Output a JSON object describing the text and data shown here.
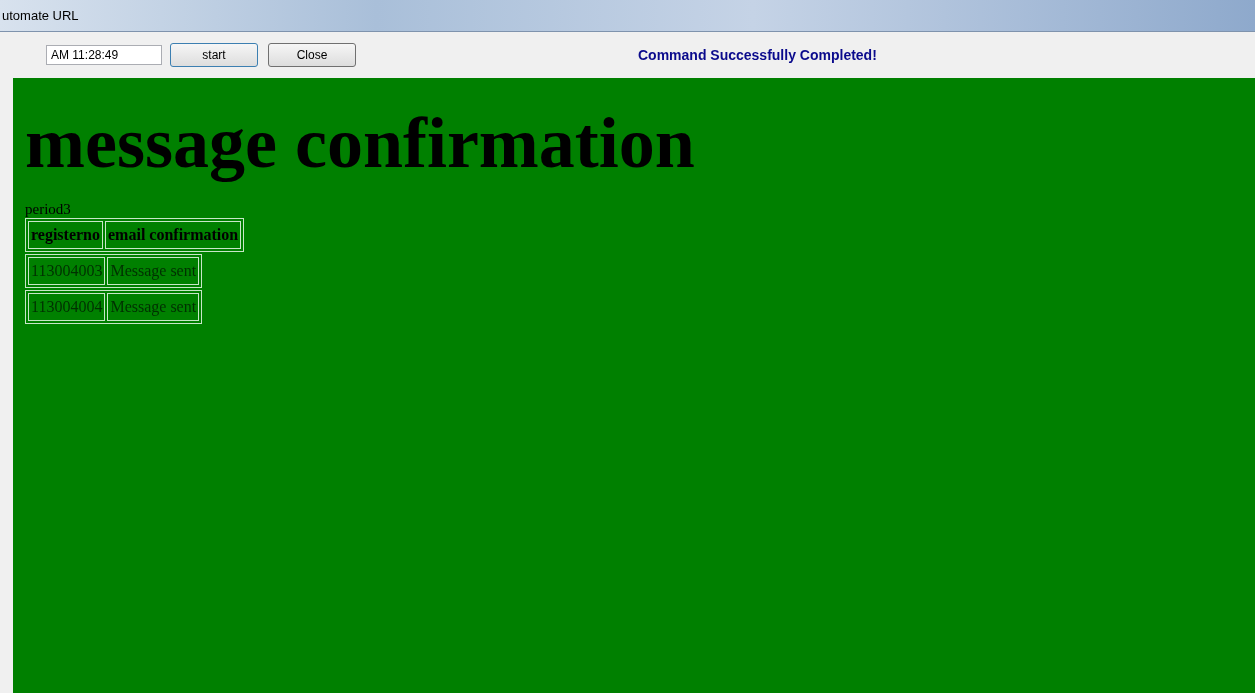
{
  "window": {
    "title": "utomate URL"
  },
  "toolbar": {
    "time_field": "AM 11:28:49",
    "buttons": [
      "start",
      "Close"
    ],
    "status": "Command Successfully Completed!"
  },
  "page": {
    "heading": "message confirmation",
    "caption": "period3",
    "tables": [
      {
        "kind": "header",
        "cells": [
          "registerno",
          "email confirmation"
        ]
      },
      {
        "kind": "row",
        "cells": [
          "113004003",
          "Message sent"
        ]
      },
      {
        "kind": "row",
        "cells": [
          "113004004",
          "Message sent"
        ]
      }
    ]
  }
}
